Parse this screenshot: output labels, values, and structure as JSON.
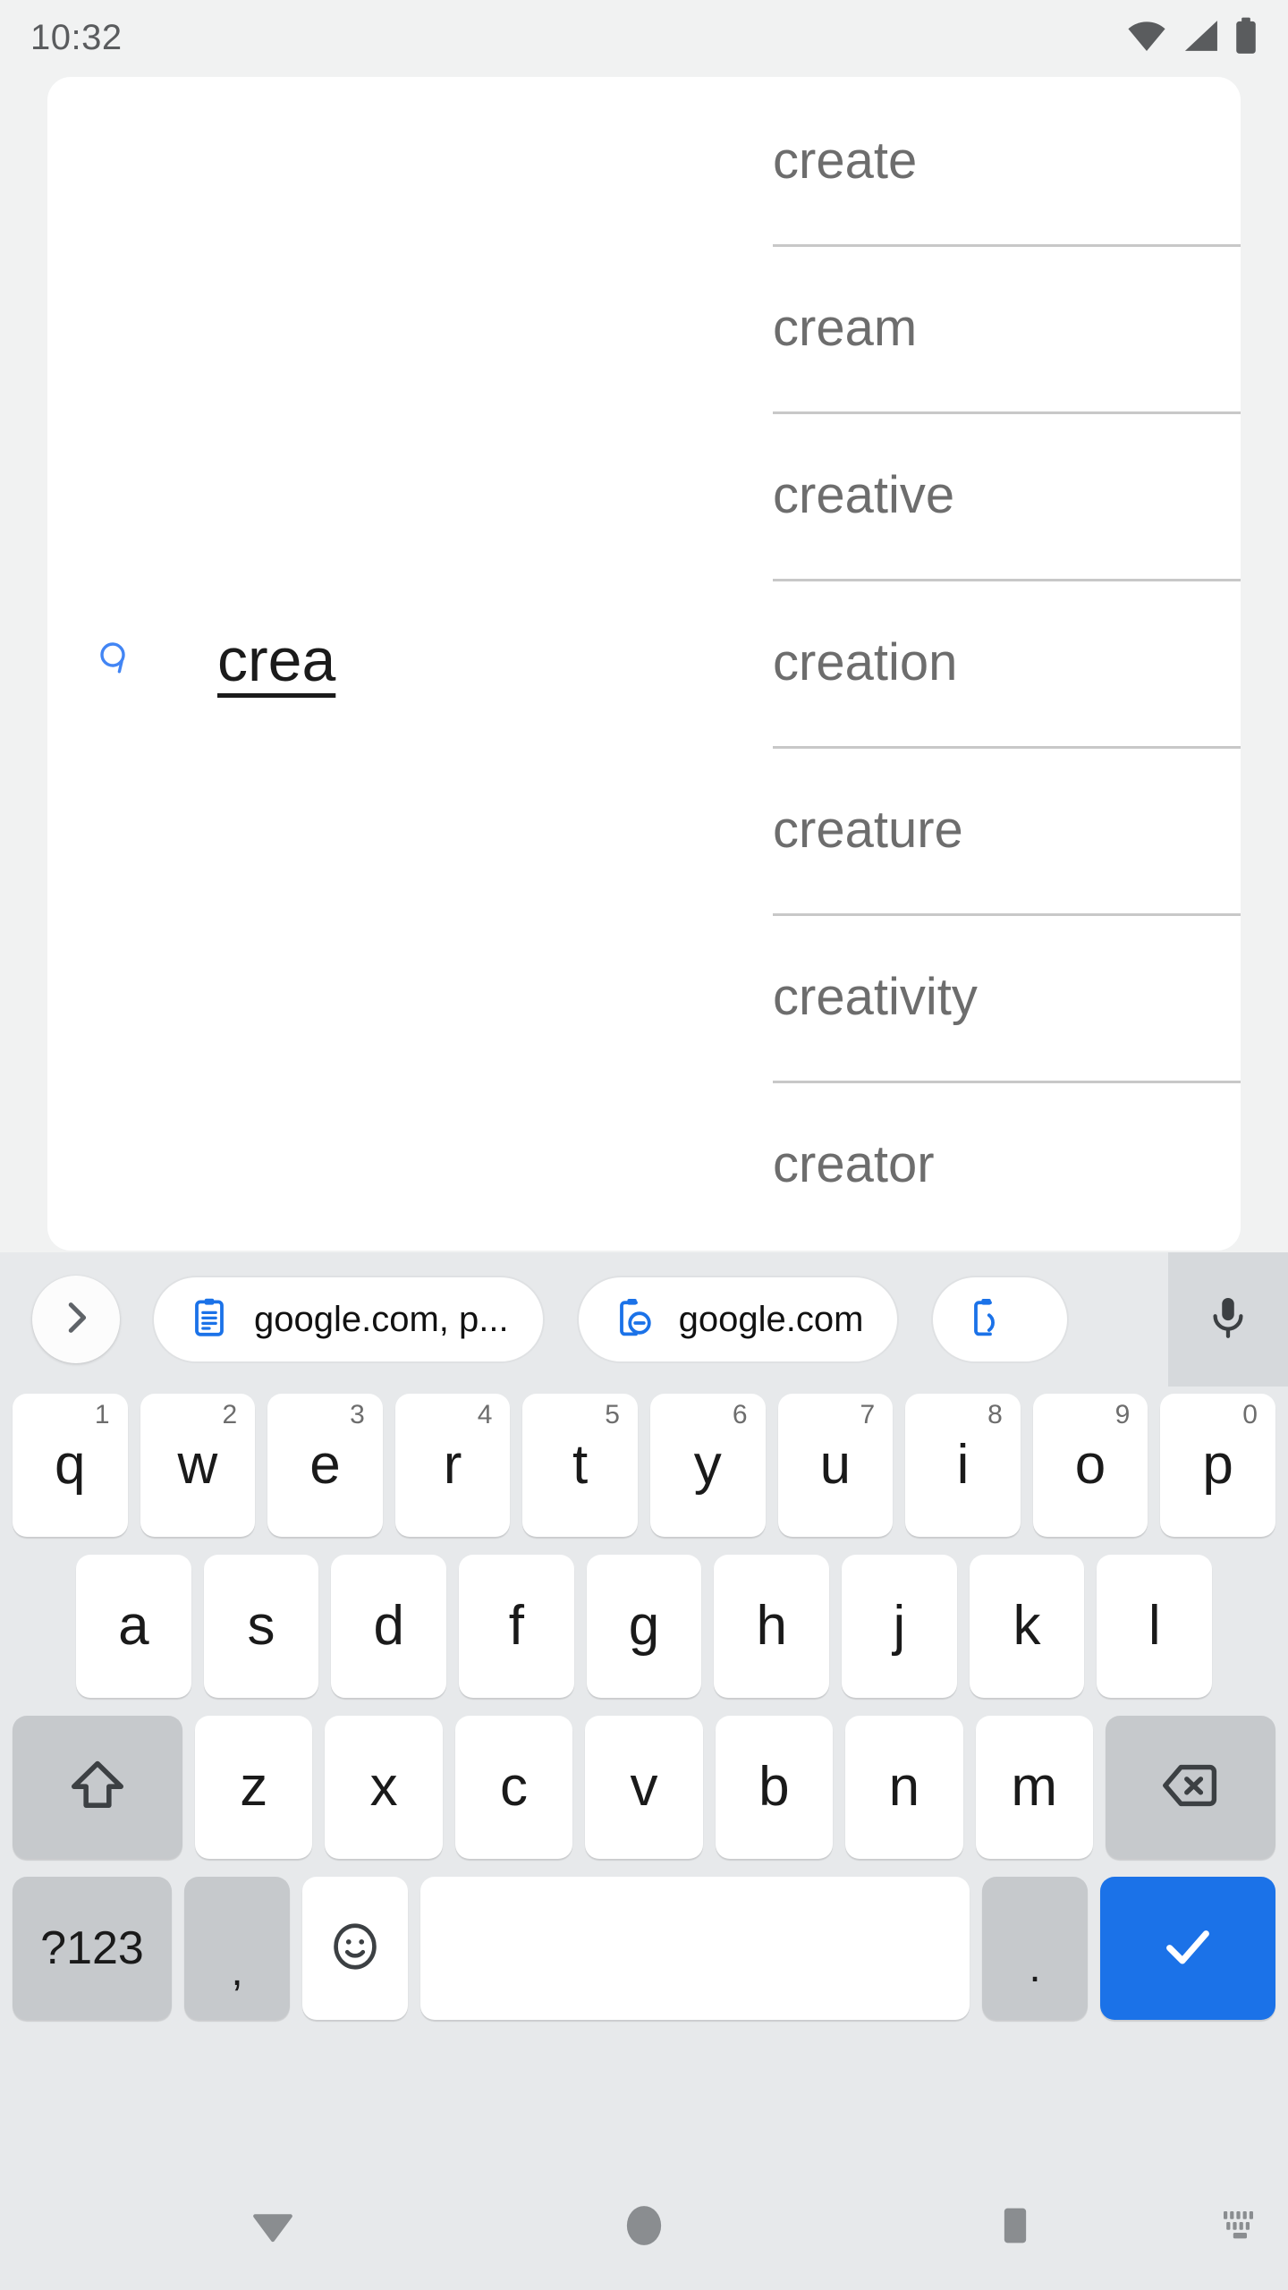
{
  "status_bar": {
    "clock": "10:32",
    "icons": [
      "wifi-icon",
      "cellular-signal-icon",
      "battery-icon"
    ],
    "icon_color": "#5a5c5e",
    "background": "#f1f2f2"
  },
  "app_card": {
    "background": "#ffffff",
    "compose": {
      "text": "crea",
      "handle_icon": "text-cursor-handle-icon",
      "handle_color": "#4285f4",
      "text_color": "#1b1b1b"
    },
    "suggestions": {
      "text_color": "#6d6d6d",
      "divider_color": "#c8c8c8",
      "items": [
        {
          "label": "create"
        },
        {
          "label": "cream"
        },
        {
          "label": "creative"
        },
        {
          "label": "creation"
        },
        {
          "label": "creature"
        },
        {
          "label": "creativity"
        },
        {
          "label": "creator"
        }
      ]
    }
  },
  "keyboard": {
    "background": "#e7e9eb",
    "key_background": "#ffffff",
    "modifier_background": "#c6c9cc",
    "accent": "#1b72e8",
    "clipboard_strip": {
      "expand_icon": "chevron-right-icon",
      "mic_icon": "microphone-icon",
      "chips": [
        {
          "icon": "clipboard-text-icon",
          "label": "google.com, p..."
        },
        {
          "icon": "clipboard-link-icon",
          "label": "google.com"
        },
        {
          "icon": "clipboard-icon",
          "label": ""
        }
      ]
    },
    "rows": [
      {
        "id": "row1",
        "keys": [
          {
            "label": "q",
            "num": "1"
          },
          {
            "label": "w",
            "num": "2"
          },
          {
            "label": "e",
            "num": "3"
          },
          {
            "label": "r",
            "num": "4"
          },
          {
            "label": "t",
            "num": "5"
          },
          {
            "label": "y",
            "num": "6"
          },
          {
            "label": "u",
            "num": "7"
          },
          {
            "label": "i",
            "num": "8"
          },
          {
            "label": "o",
            "num": "9"
          },
          {
            "label": "p",
            "num": "0"
          }
        ]
      },
      {
        "id": "row2",
        "keys": [
          {
            "label": "a"
          },
          {
            "label": "s"
          },
          {
            "label": "d"
          },
          {
            "label": "f"
          },
          {
            "label": "g"
          },
          {
            "label": "h"
          },
          {
            "label": "j"
          },
          {
            "label": "k"
          },
          {
            "label": "l"
          }
        ]
      },
      {
        "id": "row3",
        "keys": [
          {
            "label": "",
            "icon": "shift-icon"
          },
          {
            "label": "z"
          },
          {
            "label": "x"
          },
          {
            "label": "c"
          },
          {
            "label": "v"
          },
          {
            "label": "b"
          },
          {
            "label": "n"
          },
          {
            "label": "m"
          },
          {
            "label": "",
            "icon": "backspace-icon"
          }
        ]
      },
      {
        "id": "row4",
        "keys": [
          {
            "label": "?123"
          },
          {
            "label": ","
          },
          {
            "label": "",
            "icon": "emoji-icon"
          },
          {
            "label": "",
            "icon": "spacebar"
          },
          {
            "label": "."
          },
          {
            "label": "",
            "icon": "check-icon"
          }
        ]
      }
    ]
  },
  "nav_bar": {
    "background": "#e7e9eb",
    "icon_color": "#8a8d90",
    "buttons": [
      {
        "name": "back",
        "icon": "down-triangle-icon"
      },
      {
        "name": "home",
        "icon": "circle-icon"
      },
      {
        "name": "recents",
        "icon": "square-icon"
      },
      {
        "name": "ime-switcher",
        "icon": "keyboard-switch-icon"
      }
    ]
  }
}
